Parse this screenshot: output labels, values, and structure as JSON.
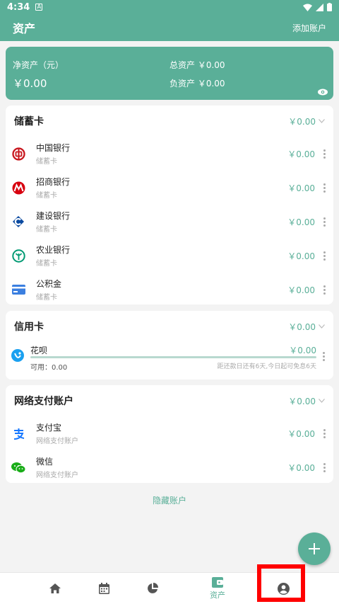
{
  "status_bar": {
    "time": "4:34",
    "badge": "A"
  },
  "app_bar": {
    "title": "资产",
    "action": "添加账户"
  },
  "summary": {
    "net_label": "净资产（元）",
    "net_value": "￥0.00",
    "total": "总资产 ￥0.00",
    "negative": "负资产 ￥0.00"
  },
  "debit": {
    "title": "储蓄卡",
    "amount": "￥0.00",
    "items": [
      {
        "name": "中国银行",
        "type": "储蓄卡",
        "value": "￥0.00"
      },
      {
        "name": "招商银行",
        "type": "储蓄卡",
        "value": "￥0.00"
      },
      {
        "name": "建设银行",
        "type": "储蓄卡",
        "value": "￥0.00"
      },
      {
        "name": "农业银行",
        "type": "储蓄卡",
        "value": "￥0.00"
      },
      {
        "name": "公积金",
        "type": "储蓄卡",
        "value": "￥0.00"
      }
    ]
  },
  "credit": {
    "title": "信用卡",
    "amount": "￥0.00",
    "item": {
      "name": "花呗",
      "value": "￥0.00",
      "available": "可用：0.00",
      "due": "距还款日还有6天,今日起可免息6天"
    }
  },
  "online": {
    "title": "网络支付账户",
    "amount": "￥0.00",
    "items": [
      {
        "name": "支付宝",
        "type": "网络支付账户",
        "value": "￥0.00"
      },
      {
        "name": "微信",
        "type": "网络支付账户",
        "value": "￥0.00"
      }
    ]
  },
  "hide_link": "隐藏账户",
  "nav": {
    "assets_label": "资产"
  },
  "colors": {
    "accent": "#5aaf98",
    "highlight": "#ff0000"
  }
}
